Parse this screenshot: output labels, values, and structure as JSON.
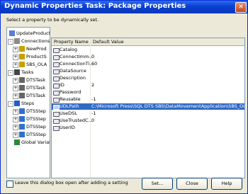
{
  "window": {
    "title": "Dynamic Properties Task: Package Properties"
  },
  "instruction": "Select a property to be dynamically set.",
  "tree": {
    "items": [
      {
        "label": "UpdateProductDi",
        "depth": 0,
        "expander": "",
        "icon": "package-icon"
      },
      {
        "label": "Connections",
        "depth": 1,
        "expander": "-",
        "icon": "connections-icon"
      },
      {
        "label": "NewProd",
        "depth": 2,
        "expander": "+",
        "icon": "connection-icon"
      },
      {
        "label": "ProductS",
        "depth": 2,
        "expander": "+",
        "icon": "connection-icon"
      },
      {
        "label": "SBS_OLA",
        "depth": 2,
        "expander": "+",
        "icon": "connection-icon"
      },
      {
        "label": "Tasks",
        "depth": 1,
        "expander": "-",
        "icon": "tasks-icon"
      },
      {
        "label": "DTSTask",
        "depth": 2,
        "expander": "+",
        "icon": "task-icon"
      },
      {
        "label": "DTSTask",
        "depth": 2,
        "expander": "+",
        "icon": "task-icon"
      },
      {
        "label": "DTSTask",
        "depth": 2,
        "expander": "+",
        "icon": "task-icon"
      },
      {
        "label": "Steps",
        "depth": 1,
        "expander": "-",
        "icon": "steps-icon"
      },
      {
        "label": "DTSStep",
        "depth": 2,
        "expander": "+",
        "icon": "step-icon"
      },
      {
        "label": "DTSStep",
        "depth": 2,
        "expander": "+",
        "icon": "step-icon"
      },
      {
        "label": "DTSStep",
        "depth": 2,
        "expander": "+",
        "icon": "step-icon"
      },
      {
        "label": "DTSStep",
        "depth": 2,
        "expander": "+",
        "icon": "step-icon"
      },
      {
        "label": "Global Variab",
        "depth": 1,
        "expander": "",
        "icon": "globe-icon"
      }
    ]
  },
  "grid": {
    "headers": [
      "Property Name",
      "Default Value"
    ],
    "rows": [
      {
        "name": "Catalog",
        "value": ""
      },
      {
        "name": "ConnectImm...",
        "value": "0"
      },
      {
        "name": "ConnectionTi...",
        "value": "60"
      },
      {
        "name": "DataSource",
        "value": ""
      },
      {
        "name": "Description",
        "value": ""
      },
      {
        "name": "ID",
        "value": "2"
      },
      {
        "name": "Password",
        "value": ""
      },
      {
        "name": "Reusable",
        "value": "-1"
      },
      {
        "name": "UDLPath",
        "value": "C:\\Microsoft Press\\SQL DTS SBS\\DataMovementApplication\\SBS_OLAP.udl",
        "selected": true
      },
      {
        "name": "UseDSL",
        "value": "-1"
      },
      {
        "name": "UseTrustedC...",
        "value": "0"
      },
      {
        "name": "UserID",
        "value": ""
      }
    ]
  },
  "footer": {
    "checkbox_label": "Leave this dialog box open after adding a setting",
    "set_label": "Set...",
    "close_label": "Close",
    "help_label": "Help"
  },
  "colors": {
    "titlebar": "#0a3fd1",
    "selection": "#316ac5",
    "face": "#ece9d8"
  }
}
